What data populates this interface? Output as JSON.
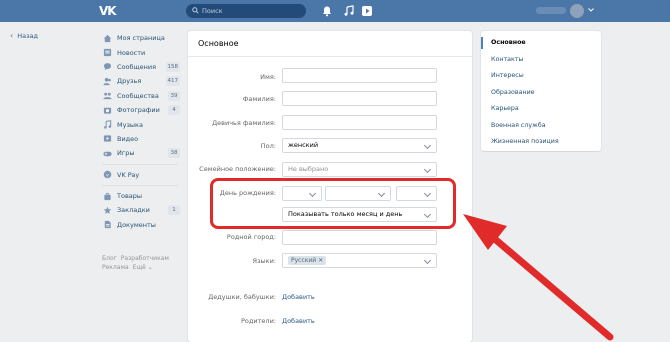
{
  "header": {
    "logo": "VK",
    "search_placeholder": "Поиск"
  },
  "back": {
    "label": "Назад"
  },
  "nav": {
    "items": [
      {
        "label": "Моя страница",
        "icon": "home-icon"
      },
      {
        "label": "Новости",
        "icon": "news-icon"
      },
      {
        "label": "Сообщения",
        "icon": "messages-icon",
        "badge": "158"
      },
      {
        "label": "Друзья",
        "icon": "friends-icon",
        "badge": "417"
      },
      {
        "label": "Сообщества",
        "icon": "groups-icon",
        "badge": "39"
      },
      {
        "label": "Фотографии",
        "icon": "photos-icon",
        "badge": "4"
      },
      {
        "label": "Музыка",
        "icon": "music-icon"
      },
      {
        "label": "Видео",
        "icon": "video-icon"
      },
      {
        "label": "Игры",
        "icon": "games-icon",
        "badge": "38"
      }
    ],
    "pay": {
      "label": "VK Pay",
      "icon": "vkpay-icon"
    },
    "extra": [
      {
        "label": "Товары",
        "icon": "goods-icon"
      },
      {
        "label": "Закладки",
        "icon": "bookmarks-icon",
        "badge": "1"
      },
      {
        "label": "Документы",
        "icon": "documents-icon"
      }
    ],
    "footer": {
      "blog": "Блог",
      "devs": "Разработчикам",
      "ads": "Реклама",
      "more": "Ещё ⌄"
    }
  },
  "main": {
    "title": "Основное",
    "fields": {
      "first_name": {
        "label": "Имя:",
        "value": ""
      },
      "last_name": {
        "label": "Фамилия:",
        "value": ""
      },
      "maiden_name": {
        "label": "Девичья фамилия:",
        "value": ""
      },
      "sex": {
        "label": "Пол:",
        "value": "женский"
      },
      "relationship": {
        "label": "Семейное положение:",
        "value": "Не выбрано"
      },
      "birthday": {
        "label": "День рождения:",
        "day": "",
        "month": "",
        "year": "",
        "visibility": "Показывать только месяц и день"
      },
      "hometown": {
        "label": "Родной город:",
        "value": ""
      },
      "languages": {
        "label": "Языки:",
        "chip": "Русский",
        "chip_remove": "✕"
      },
      "grandparents": {
        "label": "Дедушки, бабушки:",
        "action": "Добавить"
      },
      "parents": {
        "label": "Родители:",
        "action": "Добавить"
      }
    }
  },
  "rmenu": {
    "items": [
      {
        "label": "Основное",
        "active": true
      },
      {
        "label": "Контакты"
      },
      {
        "label": "Интересы"
      },
      {
        "label": "Образование"
      },
      {
        "label": "Карьера"
      },
      {
        "label": "Военная служба"
      },
      {
        "label": "Жизненная позиция"
      }
    ]
  },
  "colors": {
    "header": "#4a76a8",
    "link": "#2a5885",
    "highlight": "#e12a2a"
  }
}
